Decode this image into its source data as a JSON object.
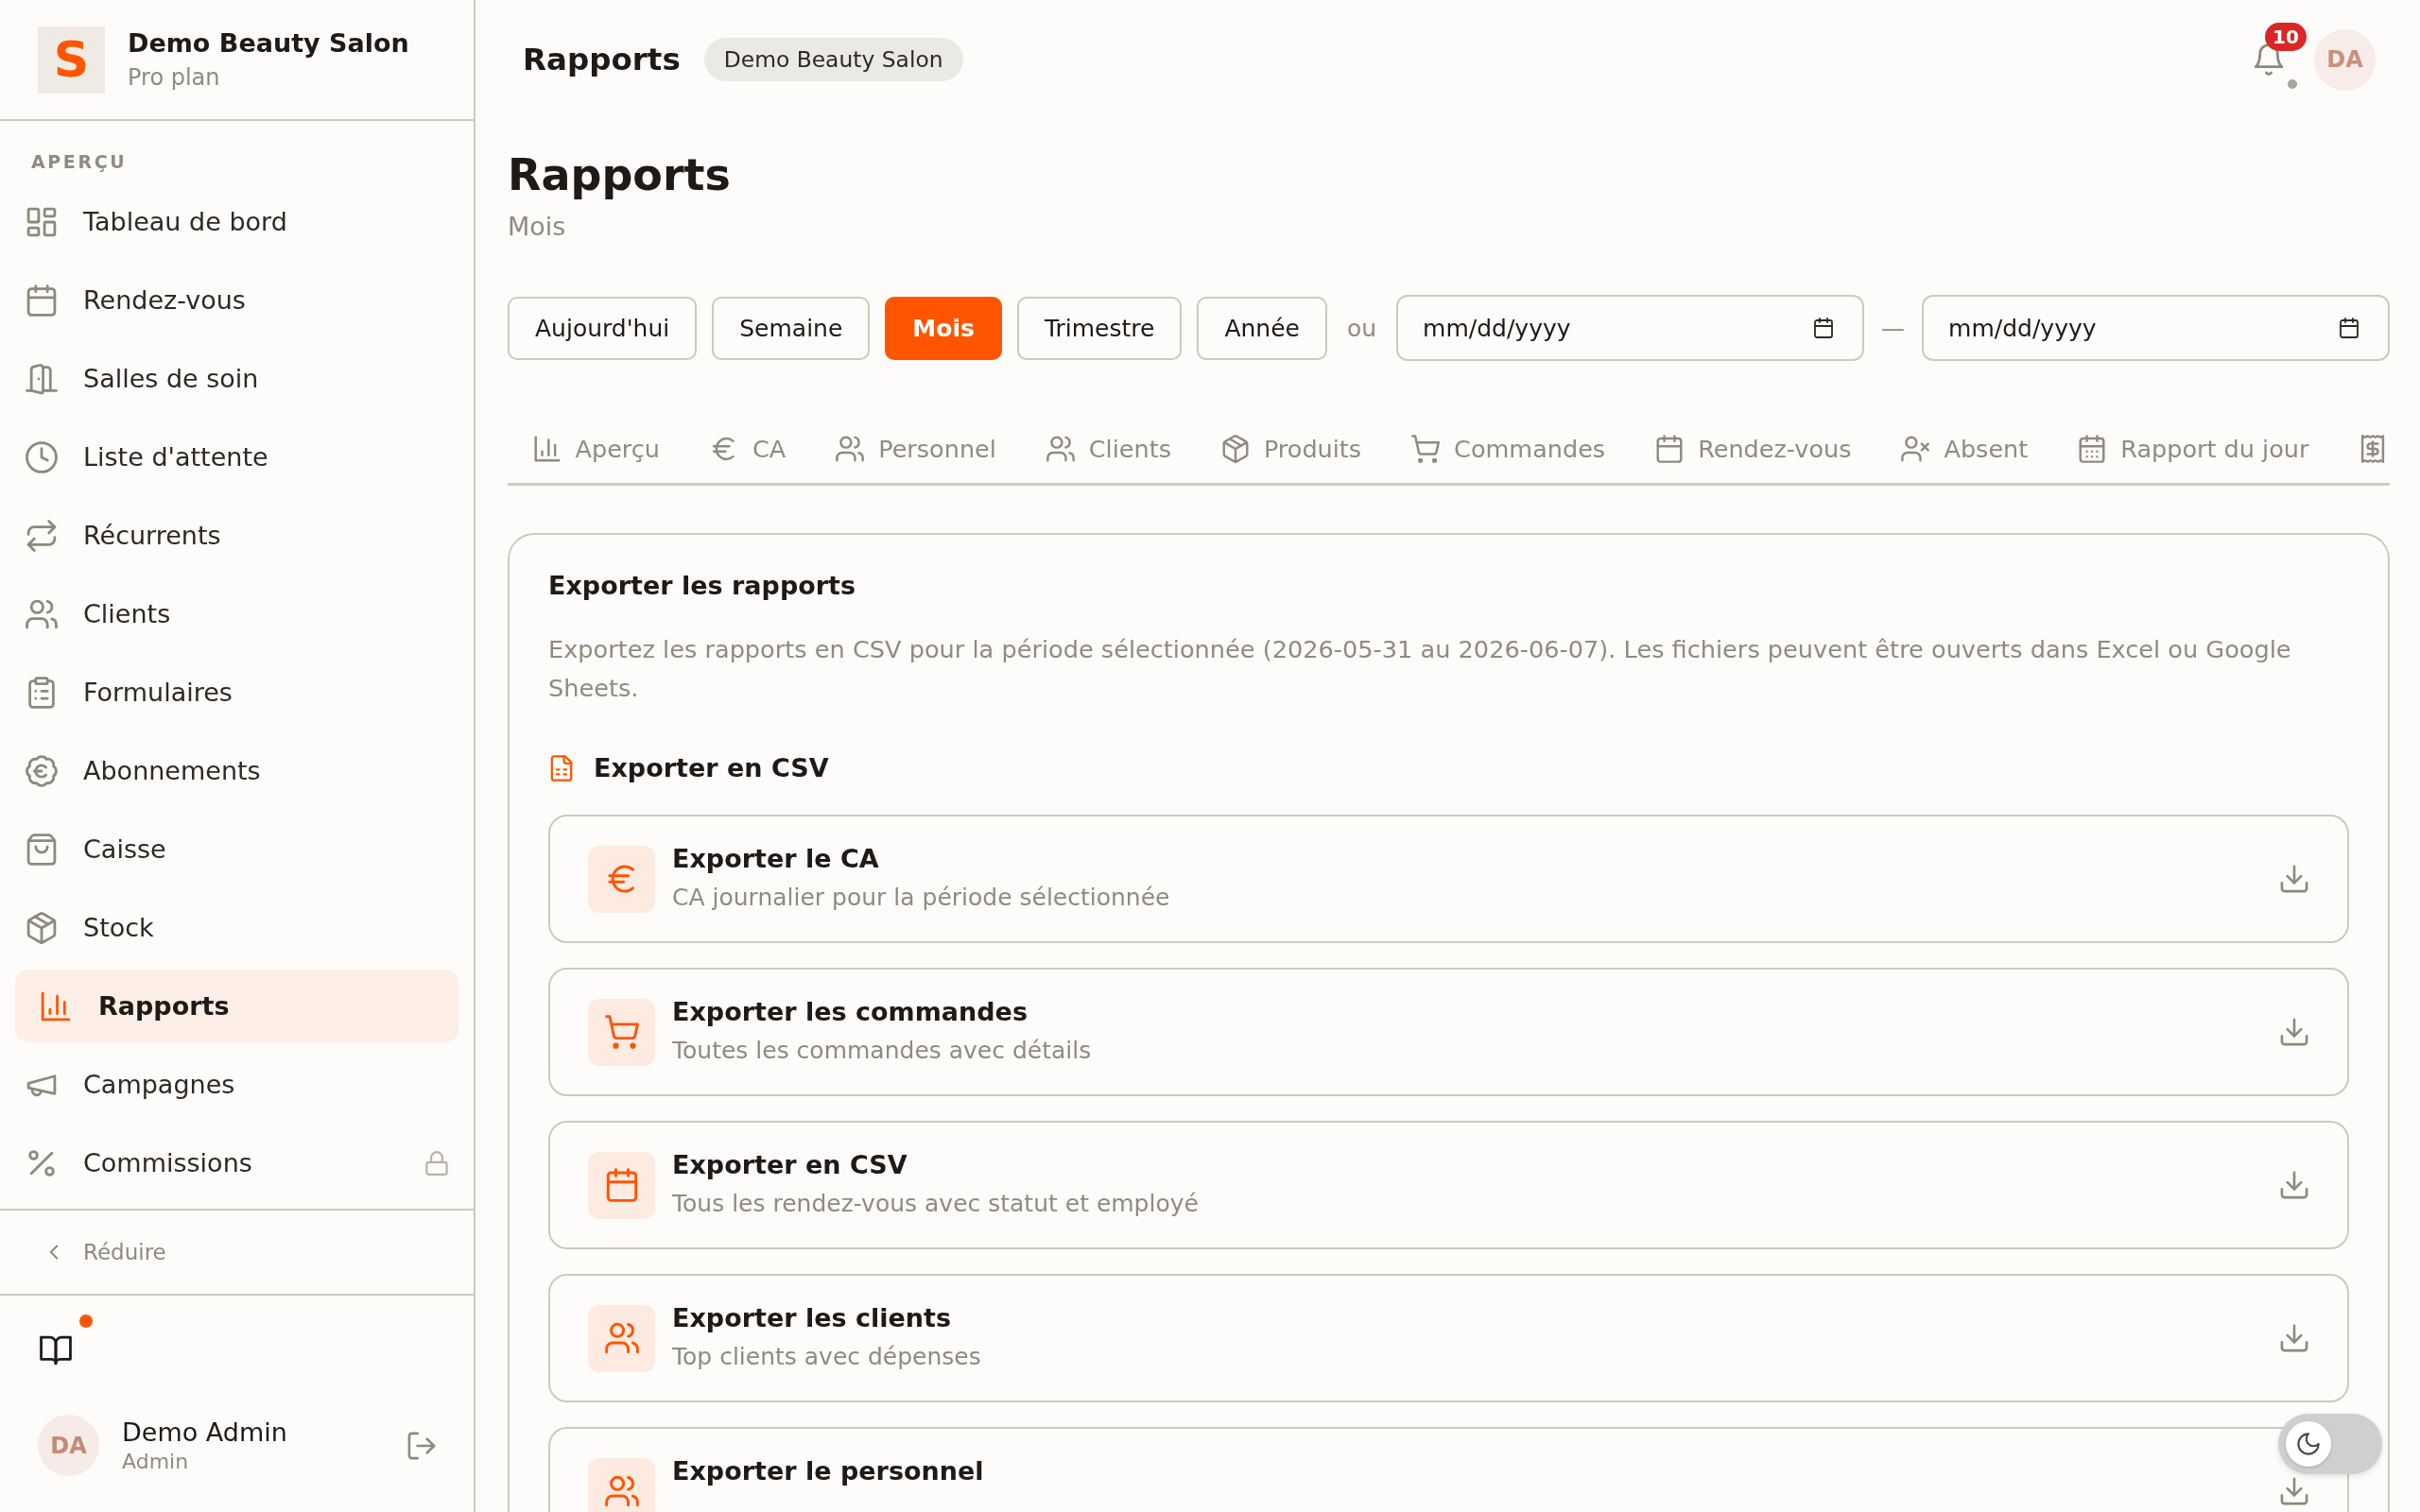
{
  "sidebar": {
    "logo": "S",
    "name": "Demo Beauty Salon",
    "plan": "Pro plan",
    "section_label": "APERÇU",
    "items": [
      {
        "label": "Tableau de bord",
        "selected": false,
        "locked": false
      },
      {
        "label": "Rendez-vous",
        "selected": false,
        "locked": false
      },
      {
        "label": "Salles de soin",
        "selected": false,
        "locked": false
      },
      {
        "label": "Liste d'attente",
        "selected": false,
        "locked": false
      },
      {
        "label": "Récurrents",
        "selected": false,
        "locked": false
      },
      {
        "label": "Clients",
        "selected": false,
        "locked": false
      },
      {
        "label": "Formulaires",
        "selected": false,
        "locked": false
      },
      {
        "label": "Abonnements",
        "selected": false,
        "locked": false
      },
      {
        "label": "Caisse",
        "selected": false,
        "locked": false
      },
      {
        "label": "Stock",
        "selected": false,
        "locked": false
      },
      {
        "label": "Rapports",
        "selected": true,
        "locked": false
      },
      {
        "label": "Campagnes",
        "selected": false,
        "locked": false
      },
      {
        "label": "Commissions",
        "selected": false,
        "locked": true
      }
    ],
    "collapse_label": "Réduire",
    "guide": {
      "unread": true
    },
    "user": {
      "initials": "DA",
      "name": "Demo Admin",
      "role": "Admin"
    }
  },
  "header": {
    "title": "Rapports",
    "badge": "Demo Beauty Salon",
    "notification_count": "10",
    "avatar_initials": "DA"
  },
  "page": {
    "title": "Rapports",
    "subtitle": "Mois"
  },
  "period_buttons": [
    {
      "label": "Aujourd'hui",
      "selected": false
    },
    {
      "label": "Semaine",
      "selected": false
    },
    {
      "label": "Mois",
      "selected": true
    },
    {
      "label": "Trimestre",
      "selected": false
    },
    {
      "label": "Année",
      "selected": false
    }
  ],
  "or_label": "ou",
  "date_range": {
    "start_placeholder": "mm/dd/yyyy",
    "separator": "—",
    "end_placeholder": "mm/dd/yyyy"
  },
  "tabs": [
    {
      "label": "Aperçu",
      "selected": false
    },
    {
      "label": "CA",
      "selected": false
    },
    {
      "label": "Personnel",
      "selected": false
    },
    {
      "label": "Clients",
      "selected": false
    },
    {
      "label": "Produits",
      "selected": false
    },
    {
      "label": "Commandes",
      "selected": false
    },
    {
      "label": "Rendez-vous",
      "selected": false
    },
    {
      "label": "Absent",
      "selected": false
    },
    {
      "label": "Rapport du jour",
      "selected": false
    },
    {
      "selected": false
    }
  ],
  "export": {
    "title": "Exporter les rapports",
    "description": "Exportez les rapports en CSV pour la période sélectionnée (2026-05-31 au 2026-06-07). Les fichiers peuvent être ouverts dans Excel ou Google Sheets.",
    "section_title": "Exporter en CSV",
    "items": [
      {
        "title": "Exporter le CA",
        "subtitle": "CA journalier pour la période sélectionnée"
      },
      {
        "title": "Exporter les commandes",
        "subtitle": "Toutes les commandes avec détails"
      },
      {
        "title": "Exporter en CSV",
        "subtitle": "Tous les rendez-vous avec statut et employé"
      },
      {
        "title": "Exporter les clients",
        "subtitle": "Top clients avec dépenses"
      },
      {
        "title": "Exporter le personnel"
      }
    ]
  },
  "theme_toggle": {
    "on": false
  }
}
